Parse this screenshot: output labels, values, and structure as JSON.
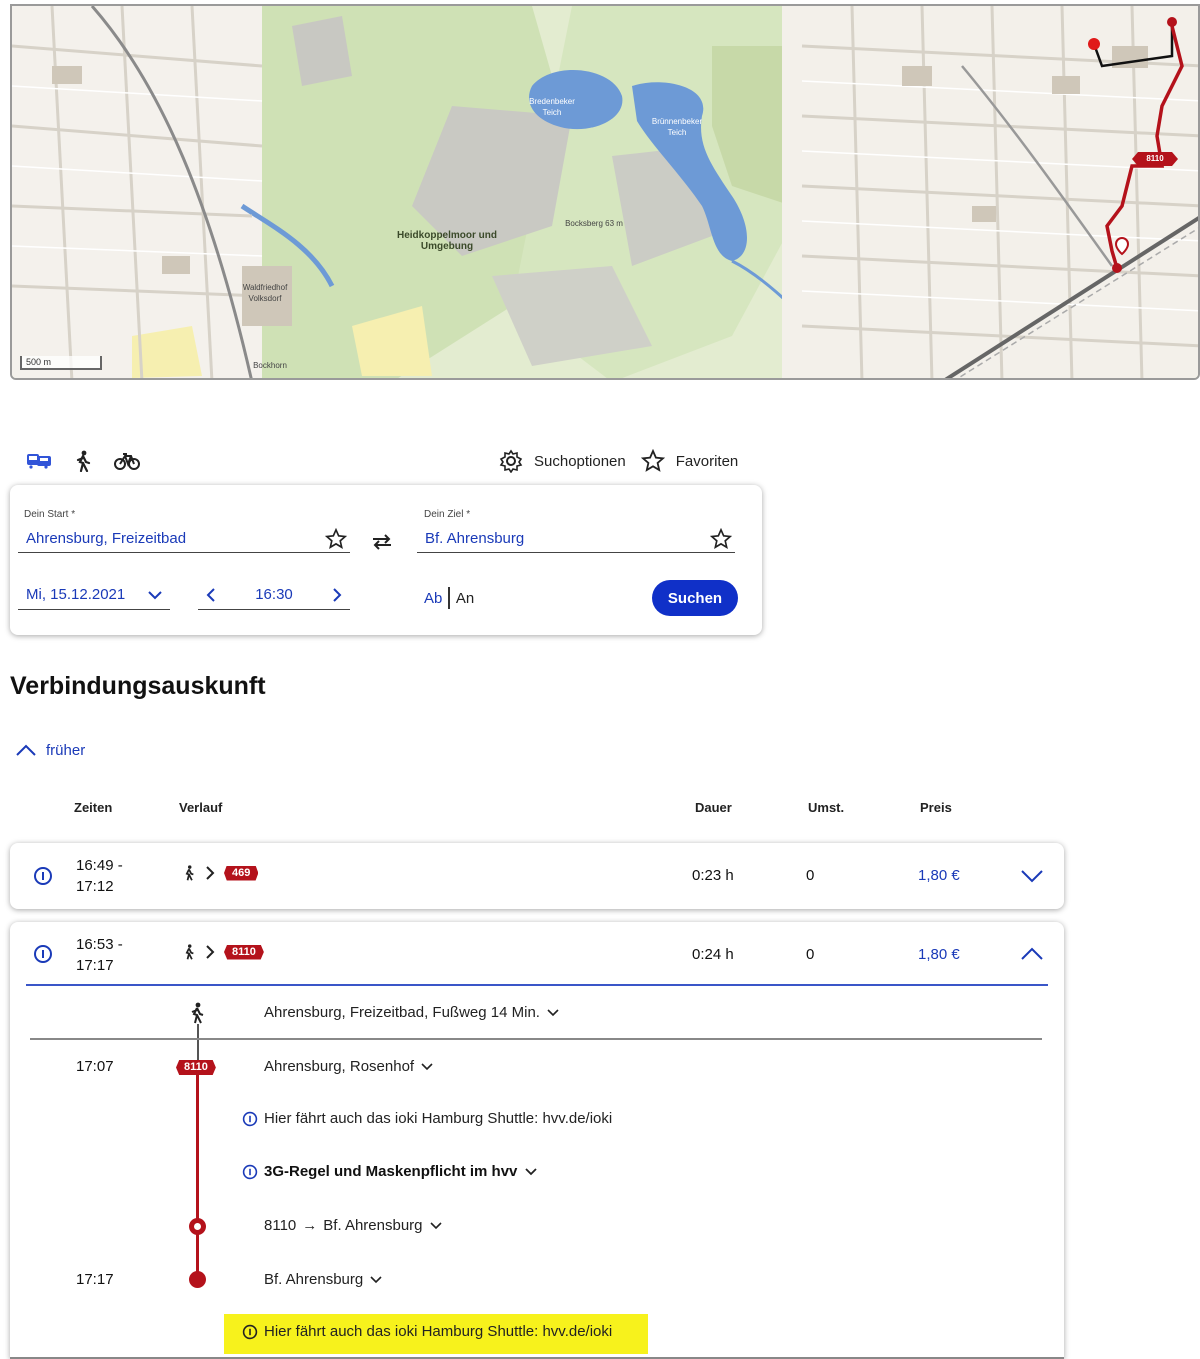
{
  "map": {
    "scale_label": "500 m",
    "labels": {
      "heidkoppel": "Heidkoppelmoor und Umgebung",
      "waldfriedhof": "Waldfriedhof Volksdorf",
      "bocksberg": "Bocksberg 63 m",
      "bredenbeker": "Bredenbeker Teich",
      "bruenenbeker": "Brünnenbeker Teich",
      "bockhorn": "Bockhorn"
    },
    "route_badge": "8110",
    "colors": {
      "route": "#b4121b",
      "water": "#6d9ad6",
      "forest": "#dfe9c7"
    }
  },
  "modes": {
    "transit_icon": "bus-train-icon",
    "walk_icon": "walking-icon",
    "bike_icon": "bicycle-icon"
  },
  "options": {
    "suchoptionen": "Suchoptionen",
    "favoriten": "Favoriten"
  },
  "search": {
    "start_label": "Dein Start *",
    "start_value": "Ahrensburg, Freizeitbad",
    "ziel_label": "Dein Ziel *",
    "ziel_value": "Bf. Ahrensburg",
    "date_value": "Mi, 15.12.2021",
    "time_value": "16:30",
    "ab": "Ab",
    "an": "An",
    "submit": "Suchen"
  },
  "results": {
    "title": "Verbindungsauskunft",
    "earlier": "früher",
    "columns": {
      "zeiten": "Zeiten",
      "verlauf": "Verlauf",
      "dauer": "Dauer",
      "umst": "Umst.",
      "preis": "Preis"
    },
    "connections": [
      {
        "dep": "16:49 -",
        "arr": "17:12",
        "line": "469",
        "dauer": "0:23 h",
        "umst": "0",
        "preis": "1,80 €"
      },
      {
        "dep": "16:53 -",
        "arr": "17:17",
        "line": "8110",
        "dauer": "0:24 h",
        "umst": "0",
        "preis": "1,80 €"
      }
    ],
    "detail": {
      "walk": "Ahrensburg, Freizeitbad, Fußweg 14 Min.",
      "dep_time": "17:07",
      "line_badge": "8110",
      "dep_stop": "Ahrensburg, Rosenhof",
      "info1": "Hier fährt auch das ioki Hamburg Shuttle: hvv.de/ioki",
      "info2": "3G-Regel und Maskenpflicht im hvv",
      "direction_line": "8110",
      "direction_arrow": "→",
      "direction_dest": "Bf. Ahrensburg",
      "arr_time": "17:17",
      "arr_stop": "Bf. Ahrensburg",
      "info3": "Hier fährt auch das ioki Hamburg Shuttle: hvv.de/ioki"
    },
    "colors": {
      "accent": "#1a3ab8",
      "line_badge": "#b4121b",
      "highlight": "#f7f21c"
    }
  }
}
